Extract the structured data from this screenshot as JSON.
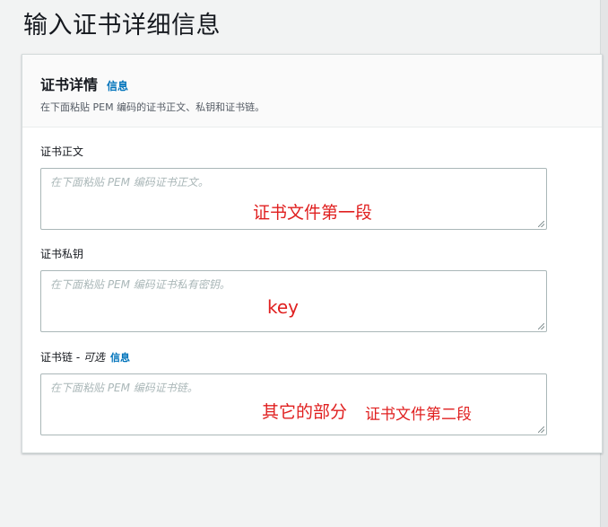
{
  "page": {
    "title": "输入证书详细信息"
  },
  "panel": {
    "title": "证书详情",
    "info_label": "信息",
    "description": "在下面粘贴 PEM 编码的证书正文、私钥和证书链。"
  },
  "fields": {
    "body": {
      "label": "证书正文",
      "value": "",
      "placeholder": "在下面粘贴 PEM 编码证书正文。"
    },
    "private_key": {
      "label": "证书私钥",
      "value": "",
      "placeholder": "在下面粘贴 PEM 编码证书私有密钥。"
    },
    "chain": {
      "label": "证书链",
      "separator": " - ",
      "optional": "可选",
      "info_label": "信息",
      "value": "",
      "placeholder": "在下面粘贴 PEM 编码证书链。"
    }
  },
  "annotations": {
    "body_note": "证书文件第一段",
    "key_note": "key",
    "chain_note_a": "其它的部分",
    "chain_note_b": "证书文件第二段",
    "color": "#e02020"
  },
  "colors": {
    "link": "#0073bb",
    "background": "#f2f3f3",
    "panel_header_bg": "#fafafa",
    "border": "#aab7b8"
  }
}
